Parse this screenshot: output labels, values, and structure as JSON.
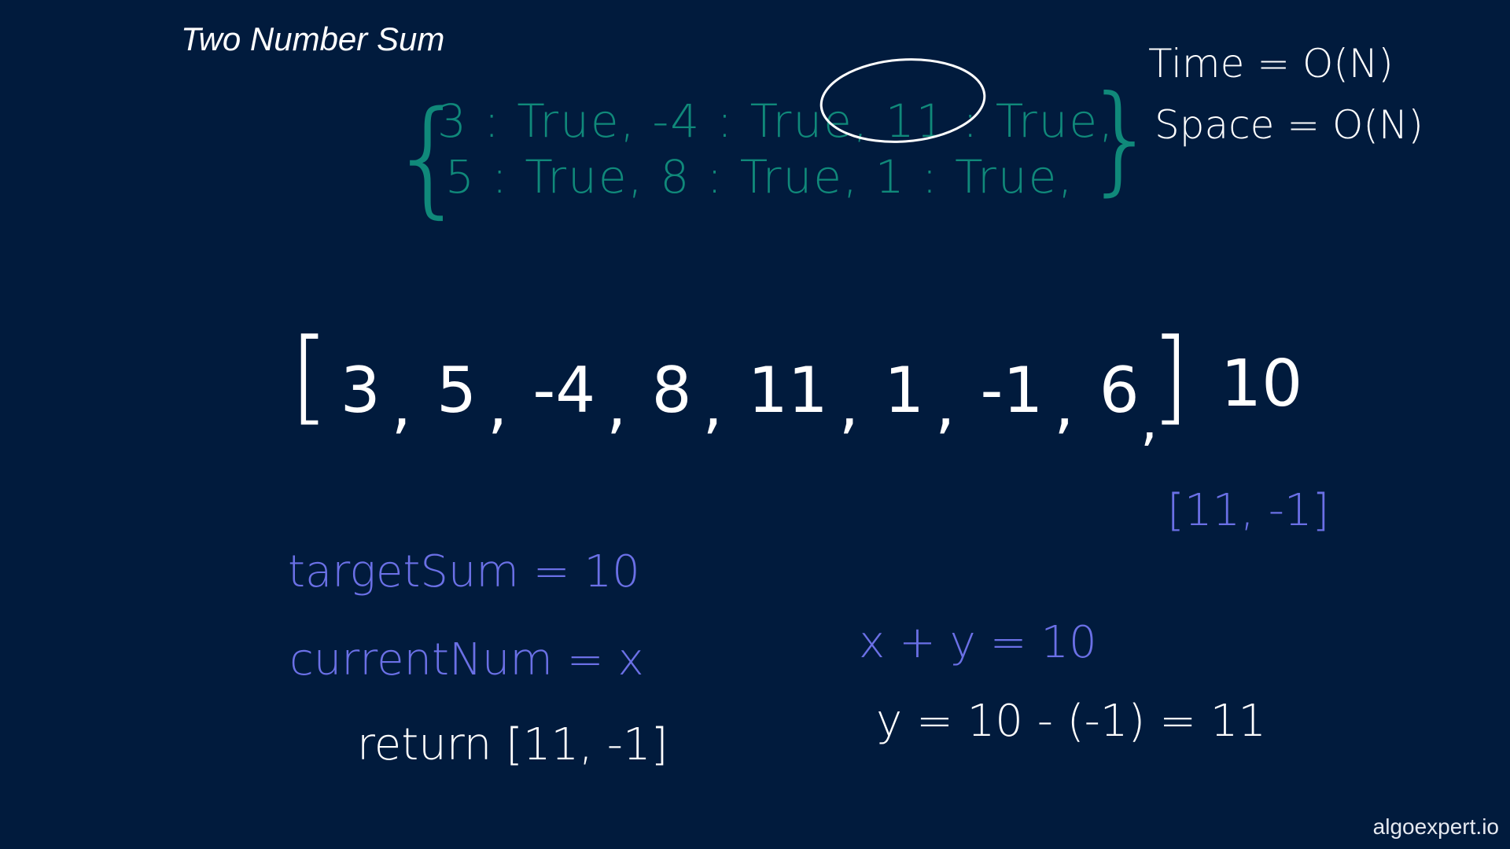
{
  "title": "Two Number Sum",
  "hash_table": {
    "row1": "3 : True,  -4 : True,  11 : True,",
    "row2": "5 : True,  8 : True,  1 : True,"
  },
  "complexity": {
    "time": "Time = O(N)",
    "space": "Space = O(N)"
  },
  "array": {
    "open_bracket": "[",
    "close_bracket": "]",
    "items": [
      "3",
      "5",
      "-4",
      "8",
      "11",
      "1",
      "-1",
      "6"
    ],
    "target": "10",
    "comma": ","
  },
  "result_pair": "[11, -1]",
  "notes": {
    "target_sum": "targetSum = 10",
    "current_num": "currentNum = x",
    "return_line": "return [11, -1]",
    "equation": "x + y = 10",
    "solve": "y = 10 - (-1) = 11"
  },
  "watermark": "algoexpert.io",
  "colors": {
    "background": "#011b3d",
    "teal_ink": "#10897a",
    "white_ink": "#ffffff",
    "blue_ink": "#6b70e6"
  }
}
